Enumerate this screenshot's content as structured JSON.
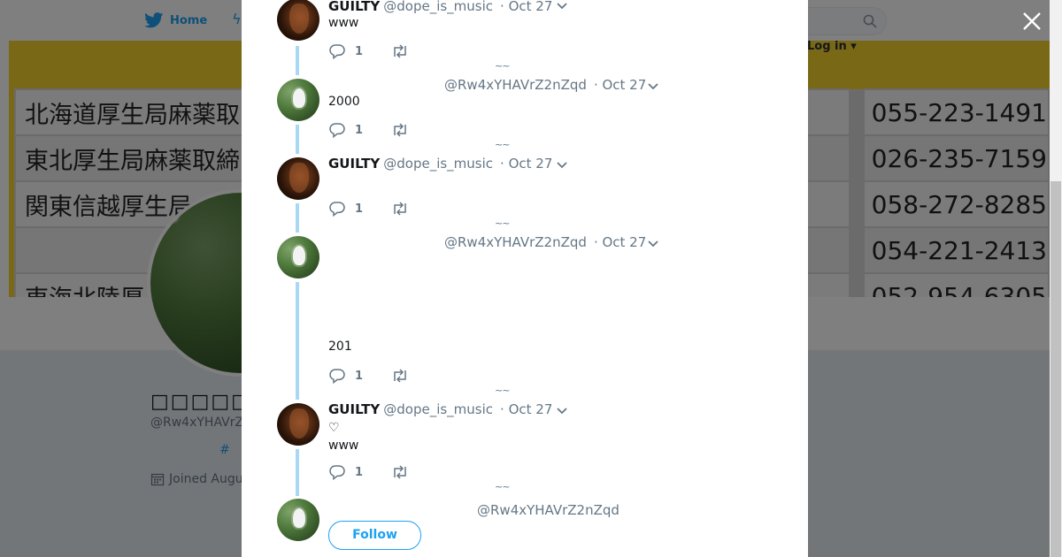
{
  "nav": {
    "home_label": "Home",
    "login_label": "Log in"
  },
  "banner": {
    "rows": [
      {
        "name": "北海道厚生局麻薬取",
        "tel": "055-223-1491"
      },
      {
        "name": "東北厚生局麻薬取締",
        "tel": "026-235-7159"
      },
      {
        "name": "関東信越厚生局",
        "tel": "058-272-8285"
      },
      {
        "name": "",
        "tel": "054-221-2413"
      },
      {
        "name": "東海北陸厚",
        "tel": "052-954-6305"
      }
    ]
  },
  "profile": {
    "name": "□□□□□□□□□□",
    "handle": "@Rw4xYHAVrZ",
    "hashtag": "#",
    "joined": "Joined Augu"
  },
  "tweets": [
    {
      "name": "GUILTY",
      "handle": "@dope_is_music",
      "date": "· Oct 27",
      "text": "www",
      "replies": "1",
      "avatar": "guilty"
    },
    {
      "name": "",
      "handle": "@Rw4xYHAVrZ2nZqd",
      "date": "· Oct 27",
      "text": "2000",
      "replies": "1",
      "avatar": "rw"
    },
    {
      "name": "GUILTY",
      "handle": "@dope_is_music",
      "date": "· Oct 27",
      "text": "",
      "replies": "1",
      "avatar": "guilty"
    },
    {
      "name": "",
      "handle": "@Rw4xYHAVrZ2nZqd",
      "date": "· Oct 27",
      "text": "201",
      "replies": "1",
      "avatar": "rw"
    },
    {
      "name": "GUILTY",
      "handle": "@dope_is_music",
      "date": "· Oct 27",
      "text": "♡\nwww",
      "replies": "1",
      "avatar": "guilty"
    }
  ],
  "reply_marker": "~~",
  "footer": {
    "handle": "@Rw4xYHAVrZ2nZqd",
    "follow_label": "Follow"
  },
  "colors": {
    "accent": "#1da1f2",
    "thread_line": "#a9d8f5",
    "banner_yellow": "#f2d22e"
  }
}
